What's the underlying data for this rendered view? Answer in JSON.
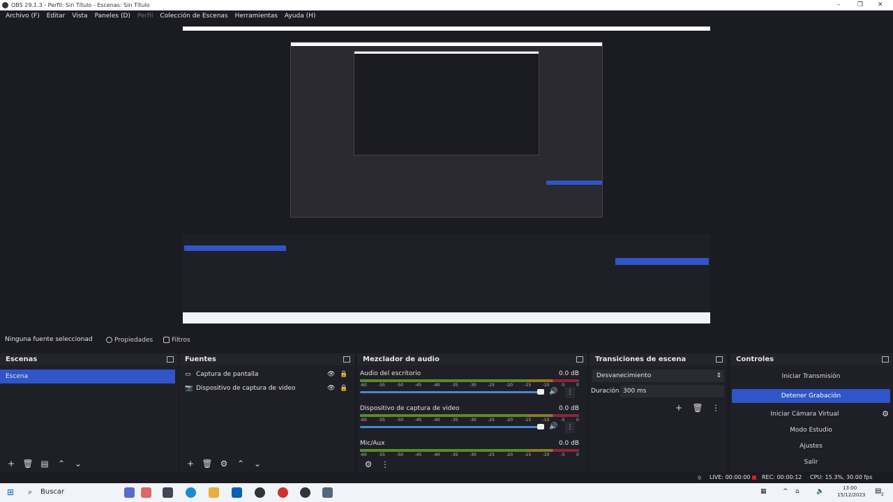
{
  "window": {
    "title": "OBS 29.1.3 - Perfil: Sin Título - Escenas: Sin Título"
  },
  "menu": [
    {
      "label": "Archivo (F)"
    },
    {
      "label": "Editar"
    },
    {
      "label": "Vista"
    },
    {
      "label": "Paneles (D)"
    },
    {
      "label": "Perfil",
      "disabled": true
    },
    {
      "label": "Colección de Escenas"
    },
    {
      "label": "Herramientas"
    },
    {
      "label": "Ayuda (H)"
    }
  ],
  "source_bar": {
    "no_selection": "Ninguna fuente seleccionad",
    "properties": "Propiedades",
    "filters": "Filtros"
  },
  "scenes": {
    "title": "Escenas",
    "items": [
      "Escena"
    ]
  },
  "sources": {
    "title": "Fuentes",
    "items": [
      {
        "label": "Captura de pantalla",
        "icon": "monitor-icon"
      },
      {
        "label": "Dispositivo de captura de video",
        "icon": "camera-icon"
      }
    ]
  },
  "mixer": {
    "title": "Mezclador de audio",
    "ticks": [
      "-60",
      "-55",
      "-50",
      "-45",
      "-40",
      "-35",
      "-30",
      "-25",
      "-20",
      "-15",
      "-10",
      "-5",
      "0"
    ],
    "channels": [
      {
        "name": "Audio del escritorio",
        "db": "0.0 dB",
        "volume": 1.0
      },
      {
        "name": "Dispositivo de captura de video",
        "db": "0.0 dB",
        "volume": 1.0
      },
      {
        "name": "Mic/Aux",
        "db": "0.0 dB"
      }
    ]
  },
  "transitions": {
    "title": "Transiciones de escena",
    "selected": "Desvanecimiento",
    "duration_label": "Duración",
    "duration_value": "300 ms"
  },
  "controls": {
    "title": "Controles",
    "buttons": [
      "Iniciar Transmisión",
      "Detener Grabación",
      "Iniciar Cámara Virtual",
      "Modo Estudio",
      "Ajustes",
      "Salir"
    ],
    "active_index": 1
  },
  "status": {
    "live": "LIVE: 00:00:00",
    "rec": "REC: 00:00:12",
    "cpu": "CPU: 15.3%, 30.00 fps"
  },
  "taskbar": {
    "search": "Buscar",
    "time": "13:00",
    "date": "15/12/2023",
    "notifications": "2"
  },
  "colors": {
    "accent": "#2f55c8",
    "rec": "#d0202a"
  }
}
